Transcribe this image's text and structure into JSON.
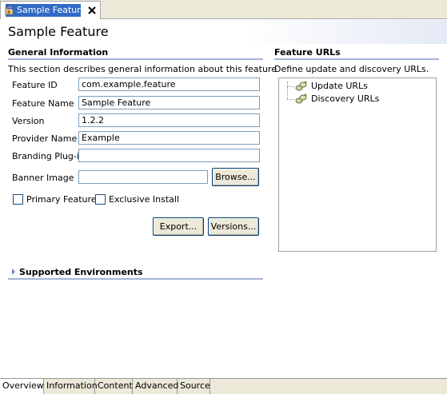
{
  "editor_tab": {
    "title": "Sample Feature",
    "icon": "feature-icon",
    "close_icon": "close-icon"
  },
  "page": {
    "title": "Sample Feature"
  },
  "general": {
    "title": "General Information",
    "description": "This section describes general information about this feature",
    "fields": {
      "feature_id": {
        "label": "Feature ID",
        "value": "com.example.feature"
      },
      "feature_name": {
        "label": "Feature Name",
        "value": "Sample Feature"
      },
      "version": {
        "label": "Version",
        "value": "1.2.2"
      },
      "provider_name": {
        "label": "Provider Name",
        "value": "Example"
      },
      "branding_plugin": {
        "label": "Branding Plug-in",
        "value": ""
      },
      "banner_image": {
        "label": "Banner Image",
        "value": ""
      }
    },
    "browse_label": "Browse...",
    "primary_feature_label": "Primary Feature",
    "primary_feature_checked": false,
    "exclusive_install_label": "Exclusive Install",
    "exclusive_install_checked": false,
    "export_label": "Export...",
    "versions_label": "Versions..."
  },
  "environments": {
    "title": "Supported Environments",
    "expanded": false
  },
  "urls": {
    "title": "Feature URLs",
    "description": "Define update and discovery URLs.",
    "items": [
      {
        "label": "Update URLs",
        "icon": "url-icon"
      },
      {
        "label": "Discovery URLs",
        "icon": "url-icon"
      }
    ]
  },
  "bottom_tabs": [
    {
      "label": "Overview",
      "active": true
    },
    {
      "label": "Information",
      "active": false
    },
    {
      "label": "Content",
      "active": false
    },
    {
      "label": "Advanced",
      "active": false
    },
    {
      "label": "Source",
      "active": false
    }
  ],
  "colors": {
    "tab_selection": "#316ac5",
    "section_rule": "#a6b4d4",
    "chrome": "#ece9d8"
  }
}
